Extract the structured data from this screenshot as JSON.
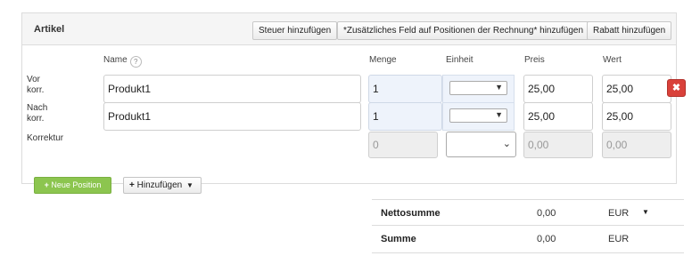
{
  "header": {
    "title": "Artikel",
    "btn_tax": "Steuer hinzufügen",
    "btn_field": "*Zusätzliches Feld auf Positionen der Rechnung* hinzufügen",
    "btn_discount": "Rabatt hinzufügen"
  },
  "columns": {
    "name": "Name",
    "menge": "Menge",
    "einheit": "Einheit",
    "preis": "Preis",
    "wert": "Wert",
    "help": "?"
  },
  "rows": [
    {
      "label_1": "Vor",
      "label_2": "korr.",
      "name": "Produkt1",
      "menge": "1",
      "einheit": "",
      "preis": "25,00",
      "wert": "25,00"
    },
    {
      "label_1": "Nach",
      "label_2": "korr.",
      "name": "Produkt1",
      "menge": "1",
      "einheit": "",
      "preis": "25,00",
      "wert": "25,00"
    },
    {
      "label_1": "Korrektur",
      "menge": "0",
      "einheit": "",
      "preis": "0,00",
      "wert": "0,00"
    }
  ],
  "actions": {
    "new_position": "Neue Position",
    "new_position_icon": "plus-icon",
    "add": "Hinzufügen",
    "add_icon": "plus-icon",
    "delete_icon": "close-icon"
  },
  "totals": {
    "netto_label": "Nettosumme",
    "netto_value": "0,00",
    "netto_currency": "EUR",
    "summe_label": "Summe",
    "summe_value": "0,00",
    "summe_currency": "EUR"
  },
  "colors": {
    "delete": "#d9413a",
    "new_position": "#8cc54f",
    "highlight": "#eef3fb"
  }
}
